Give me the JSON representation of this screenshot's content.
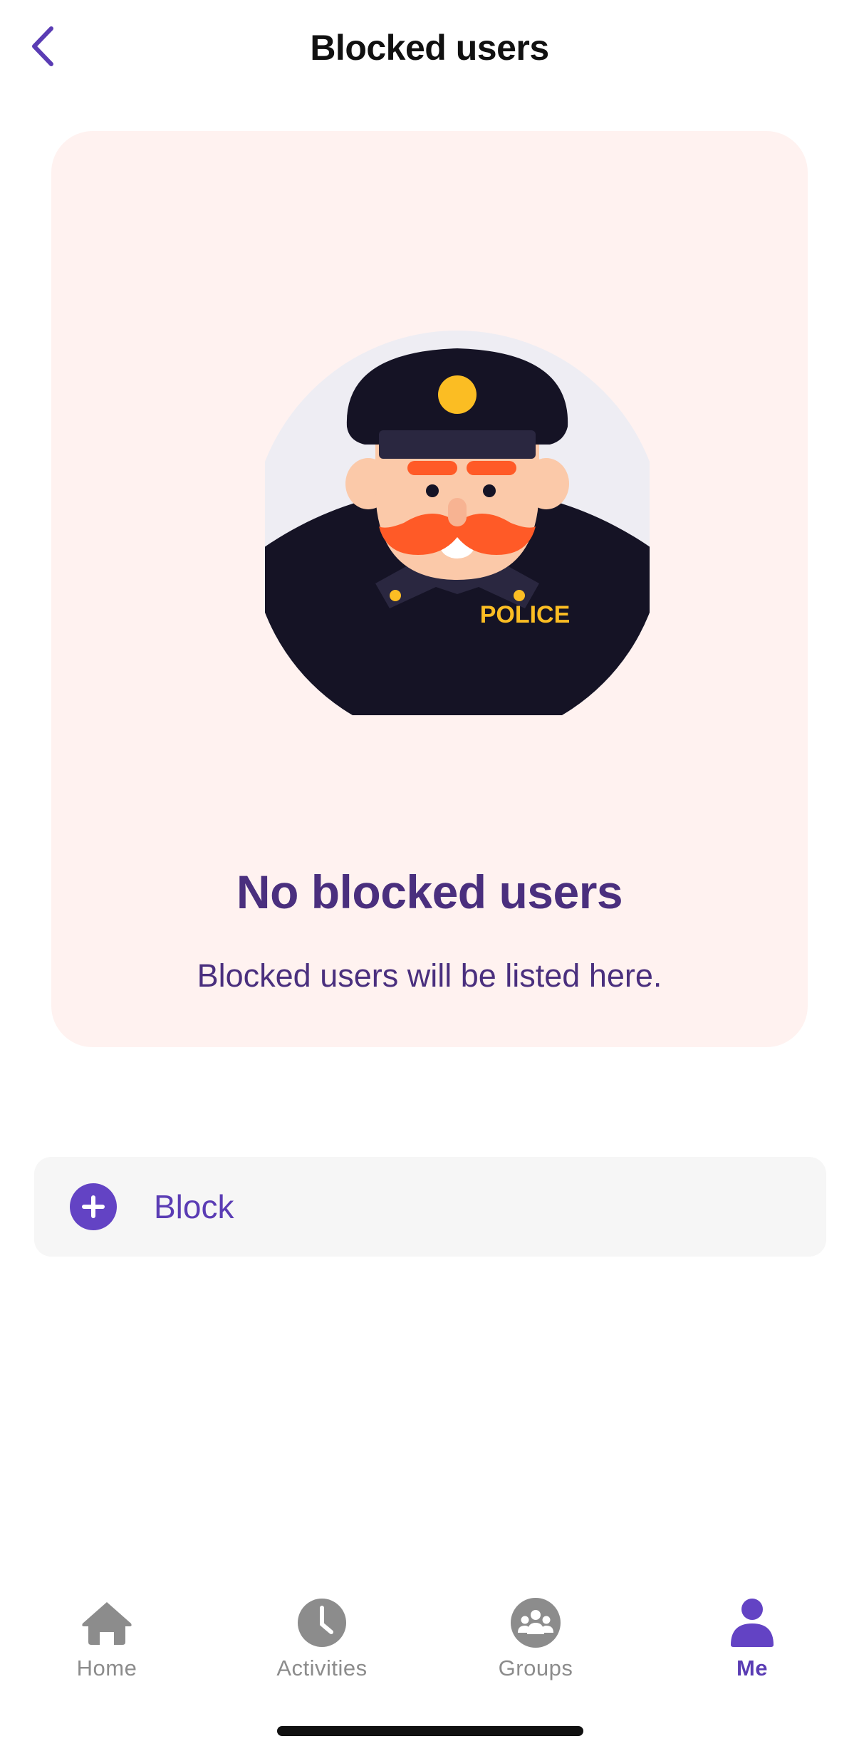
{
  "header": {
    "title": "Blocked users",
    "back_icon": "chevron-left-icon"
  },
  "empty_state": {
    "title": "No blocked users",
    "subtitle": "Blocked users will be listed here.",
    "illustration_badge_text": "POLICE"
  },
  "actions": {
    "block_label": "Block",
    "block_icon": "plus-circle-icon"
  },
  "tabbar": {
    "tabs": [
      {
        "label": "Home",
        "icon": "home-icon",
        "active": false
      },
      {
        "label": "Activities",
        "icon": "clock-icon",
        "active": false
      },
      {
        "label": "Groups",
        "icon": "group-icon",
        "active": false
      },
      {
        "label": "Me",
        "icon": "person-icon",
        "active": true
      }
    ]
  },
  "colors": {
    "accent": "#6343c4",
    "heading": "#4a2f7e",
    "card_background": "#fff2f0",
    "inactive_tab": "#8c8c8c"
  }
}
